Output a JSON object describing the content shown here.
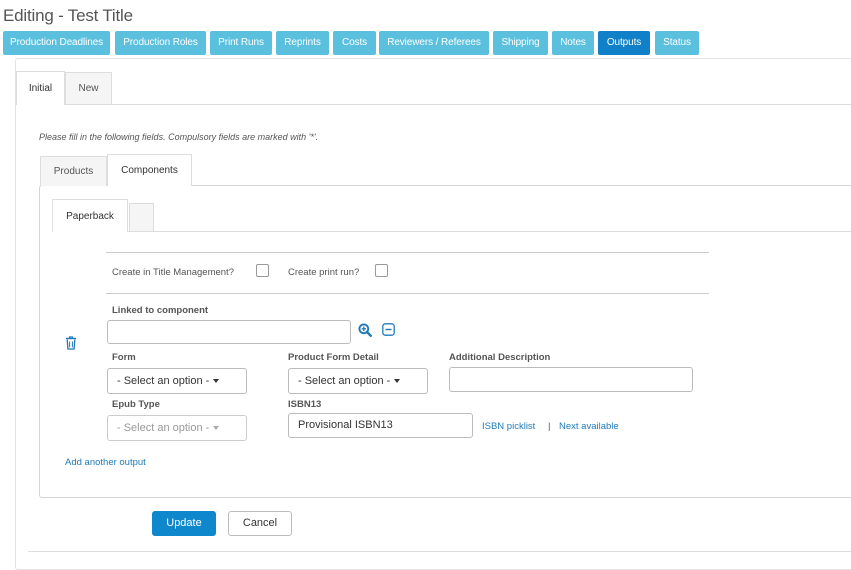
{
  "page": {
    "title": "Editing - Test Title"
  },
  "nav": {
    "items": [
      {
        "label": "Production Deadlines"
      },
      {
        "label": "Production Roles"
      },
      {
        "label": "Print Runs"
      },
      {
        "label": "Reprints"
      },
      {
        "label": "Costs"
      },
      {
        "label": "Reviewers / Referees"
      },
      {
        "label": "Shipping"
      },
      {
        "label": "Notes"
      },
      {
        "label": "Outputs",
        "active": true
      },
      {
        "label": "Status"
      }
    ]
  },
  "tabs": {
    "main": [
      "Initial",
      "New"
    ],
    "section": [
      "Products",
      "Components"
    ],
    "component": [
      "Paperback",
      ""
    ]
  },
  "form": {
    "instructions": "Please fill in the following fields. Compulsory fields are marked with '*'.",
    "create_in_title_mgmt_label": "Create in Title Management?",
    "create_print_run_label": "Create print run?",
    "linked_component_label": "Linked to component",
    "linked_component_value": "",
    "form_label": "Form",
    "form_select": "- Select an option -",
    "product_form_detail_label": "Product Form Detail",
    "product_form_detail_select": "- Select an option -",
    "additional_description_label": "Additional Description",
    "additional_description_value": "",
    "epub_type_label": "Epub Type",
    "epub_type_select": "- Select an option -",
    "isbn13_label": "ISBN13",
    "isbn13_value": "Provisional ISBN13",
    "isbn_picklist_link": "ISBN picklist",
    "separator": "|",
    "next_available_link": "Next available",
    "add_another_output_link": "Add another output"
  },
  "actions": {
    "update": "Update",
    "cancel": "Cancel"
  },
  "colors": {
    "nav_button": "#5bc0de",
    "nav_active": "#1080c8",
    "primary_button": "#0f87cc",
    "link": "#1f7ab8"
  }
}
